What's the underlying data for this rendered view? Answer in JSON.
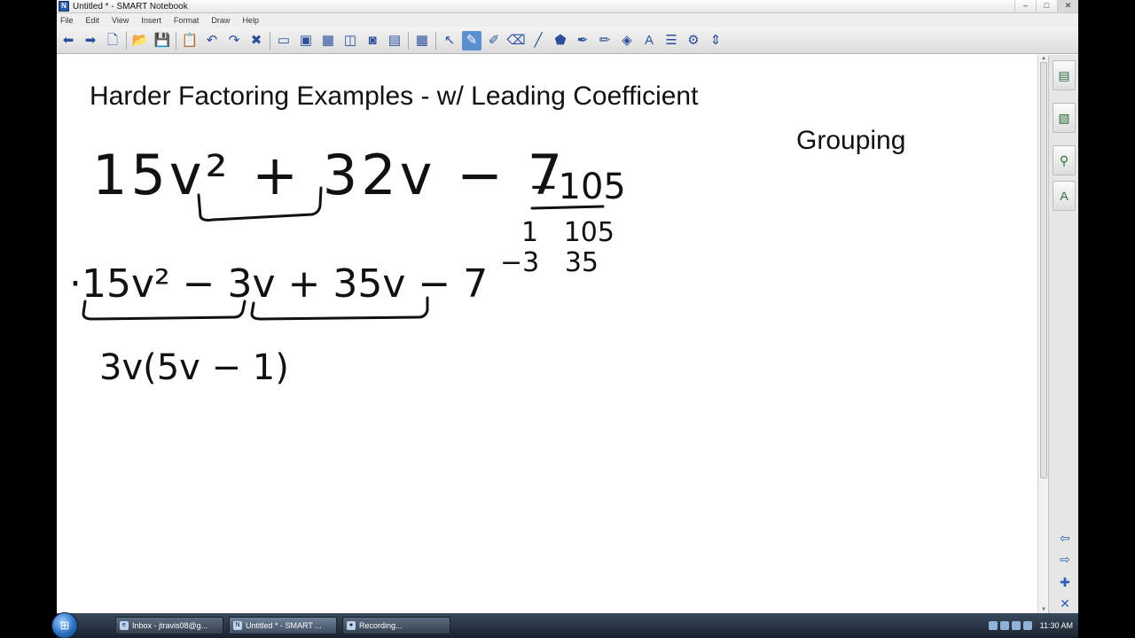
{
  "window": {
    "title": "Untitled * - SMART Notebook",
    "app_icon_glyph": "N",
    "minimize_glyph": "–",
    "maximize_glyph": "□",
    "close_glyph": "✕"
  },
  "menu": [
    "File",
    "Edit",
    "View",
    "Insert",
    "Format",
    "Draw",
    "Help"
  ],
  "toolbar": {
    "groups": [
      [
        {
          "name": "back-icon",
          "glyph": "⬅"
        },
        {
          "name": "forward-icon",
          "glyph": "➡"
        },
        {
          "name": "add-page-icon",
          "glyph": "🗋"
        }
      ],
      [
        {
          "name": "open-icon",
          "glyph": "📂"
        },
        {
          "name": "save-icon",
          "glyph": "💾"
        }
      ],
      [
        {
          "name": "paste-icon",
          "glyph": "📋"
        },
        {
          "name": "undo-icon",
          "glyph": "↶"
        },
        {
          "name": "redo-icon",
          "glyph": "↷"
        },
        {
          "name": "delete-icon",
          "glyph": "✖"
        }
      ],
      [
        {
          "name": "screen-shade-icon",
          "glyph": "▭"
        },
        {
          "name": "full-screen-icon",
          "glyph": "▣"
        },
        {
          "name": "transparent-icon",
          "glyph": "▦"
        },
        {
          "name": "dual-page-icon",
          "glyph": "◫"
        },
        {
          "name": "capture-icon",
          "glyph": "◙"
        },
        {
          "name": "media-icon",
          "glyph": "▤"
        }
      ],
      [
        {
          "name": "table-icon",
          "glyph": "▦"
        }
      ],
      [
        {
          "name": "select-icon",
          "glyph": "↖"
        },
        {
          "name": "pen-icon",
          "glyph": "✎",
          "active": true
        },
        {
          "name": "creative-pen-icon",
          "glyph": "✐"
        },
        {
          "name": "eraser-icon",
          "glyph": "⌫"
        },
        {
          "name": "line-icon",
          "glyph": "╱"
        },
        {
          "name": "shapes-icon",
          "glyph": "⬟"
        },
        {
          "name": "magic-pen-icon",
          "glyph": "✒"
        },
        {
          "name": "shape-pen-icon",
          "glyph": "✏"
        },
        {
          "name": "fill-icon",
          "glyph": "◈"
        },
        {
          "name": "text-icon",
          "glyph": "A"
        },
        {
          "name": "properties-icon",
          "glyph": "☰"
        },
        {
          "name": "settings-icon",
          "glyph": "⚙"
        },
        {
          "name": "move-toolbar-icon",
          "glyph": "⇕"
        }
      ]
    ]
  },
  "page": {
    "heading": "Harder Factoring Examples - w/ Leading Coefficient",
    "side_label": "Grouping",
    "handwriting": {
      "expression": "15v² + 32v − 7",
      "product": "−105",
      "factor_pairs": [
        "1   105",
        "−3   35"
      ],
      "split_expression": "·15v² − 3v + 35v − 7",
      "factored_step": "3v(5v − 1)"
    }
  },
  "side_panel": {
    "tabs": [
      {
        "name": "page-sorter-icon",
        "glyph": "▤"
      },
      {
        "name": "gallery-icon",
        "glyph": "▧"
      },
      {
        "name": "attachments-icon",
        "glyph": "⚲"
      },
      {
        "name": "properties-tab-icon",
        "glyph": "A"
      }
    ],
    "arrows": [
      {
        "name": "arrow-left-icon",
        "glyph": "⇦"
      },
      {
        "name": "arrow-right-icon",
        "glyph": "⇨"
      },
      {
        "name": "add-page-side-icon",
        "glyph": "✚"
      },
      {
        "name": "collapse-panel-icon",
        "glyph": "✕"
      }
    ]
  },
  "taskbar": {
    "start_glyph": "⊞",
    "items": [
      {
        "label": "Inbox - jtravis08@g...",
        "icon": "e",
        "active": false
      },
      {
        "label": "Untitled * - SMART ...",
        "icon": "N",
        "active": true
      },
      {
        "label": "Recording...",
        "icon": "●",
        "active": false
      }
    ],
    "clock": "11:30 AM"
  }
}
